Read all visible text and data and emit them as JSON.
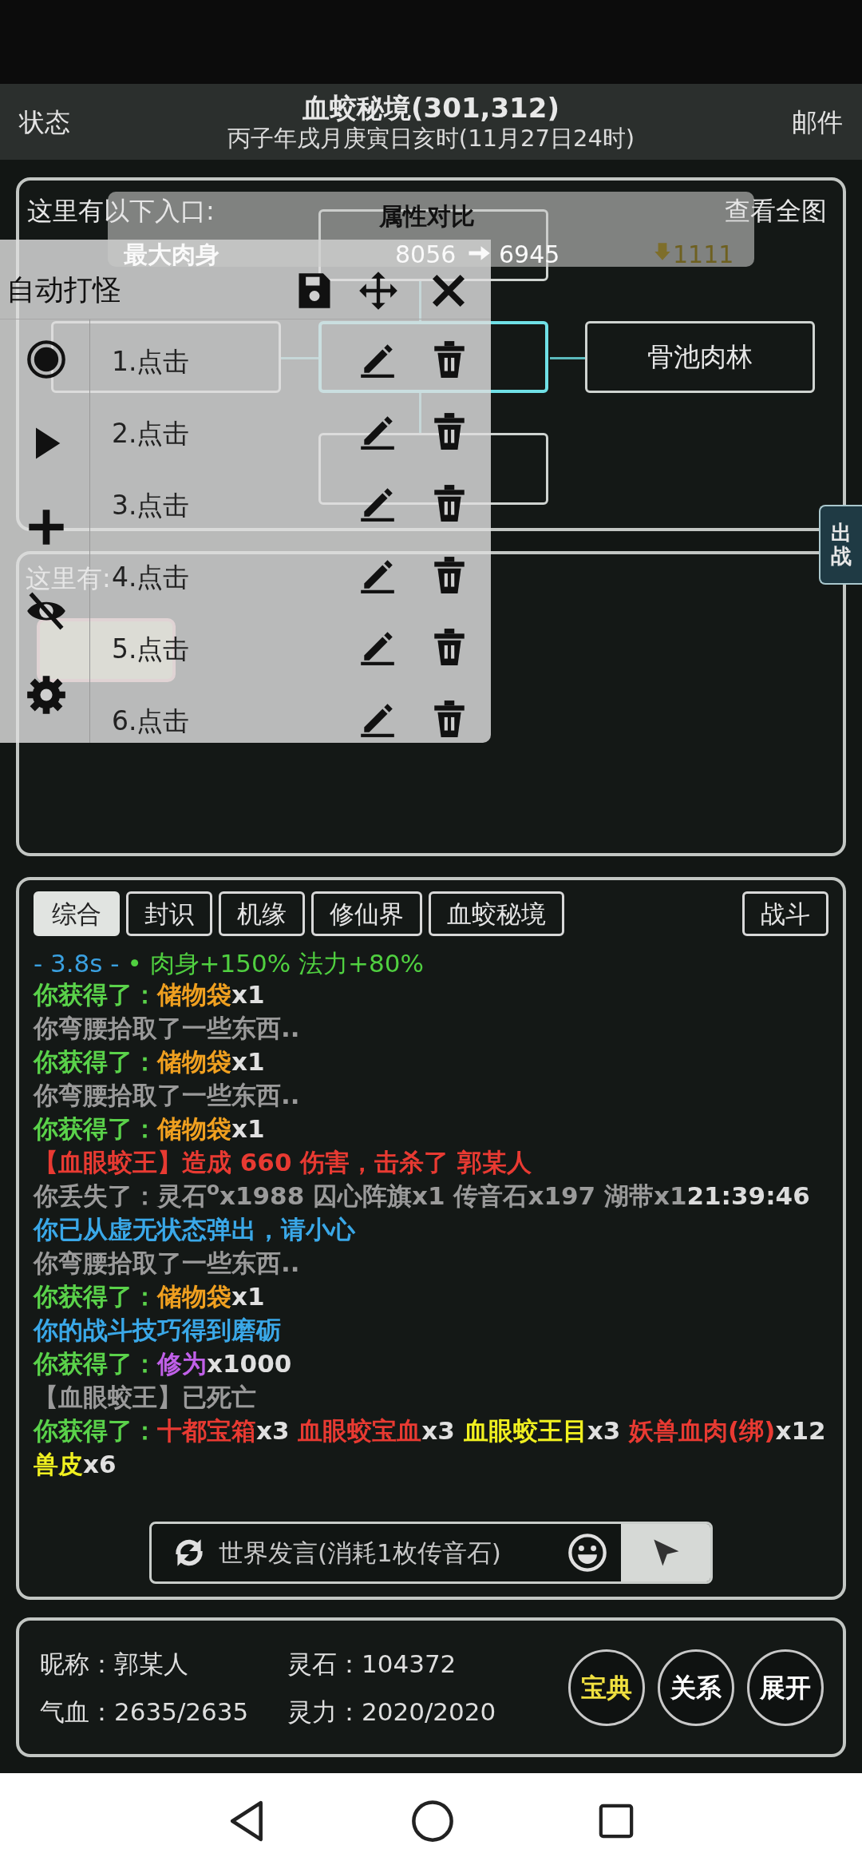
{
  "header": {
    "left": "状态",
    "title": "血蛟秘境(301,312)",
    "subtitle": "丙子年戌月庚寅日亥时(11月27日24时)",
    "right": "邮件"
  },
  "map": {
    "heading": "这里有以下入口:",
    "view_all": "查看全图",
    "nodes": [
      {
        "selected": false
      },
      {
        "selected": false
      },
      {
        "selected": true
      },
      {
        "label": "骨池肉林",
        "selected": false
      },
      {
        "selected": false
      }
    ]
  },
  "here": {
    "heading": "这里有:"
  },
  "side_tab": "出战",
  "compare": {
    "title": "属性对比",
    "rows": [
      {
        "label": "最大肉身",
        "from": "8056",
        "to": "6945",
        "diff": "1111"
      }
    ]
  },
  "auto": {
    "title": "自动打怪",
    "steps": [
      {
        "label": "1.点击"
      },
      {
        "label": "2.点击"
      },
      {
        "label": "3.点击"
      },
      {
        "label": "4.点击"
      },
      {
        "label": "5.点击"
      },
      {
        "label": "6.点击"
      }
    ]
  },
  "log": {
    "tabs": [
      {
        "label": "综合",
        "selected": true
      },
      {
        "label": "封识",
        "selected": false
      },
      {
        "label": "机缘",
        "selected": false
      },
      {
        "label": "修仙界",
        "selected": false
      },
      {
        "label": "血蛟秘境",
        "selected": false
      },
      {
        "label": "战斗",
        "selected": false
      }
    ],
    "lines": [
      {
        "kind": "timer",
        "segments": [
          {
            "text": "- 3.8s -",
            "color": "#3aa0e0"
          },
          {
            "text": " • 肉身+150% 法力+80%",
            "color": "#50d040"
          }
        ]
      },
      {
        "kind": "event",
        "segments": [
          {
            "text": "你获得了：",
            "color": "#5ad24a"
          },
          {
            "text": "储物袋",
            "color": "#f0a020"
          },
          {
            "text": "x1",
            "color": "#e0e0e0"
          }
        ]
      },
      {
        "kind": "event",
        "segments": [
          {
            "text": "你弯腰拾取了一些东西..",
            "color": "#9a9a9a"
          }
        ]
      },
      {
        "kind": "event",
        "segments": [
          {
            "text": "你获得了：",
            "color": "#5ad24a"
          },
          {
            "text": "储物袋",
            "color": "#f0a020"
          },
          {
            "text": "x1",
            "color": "#e0e0e0"
          }
        ]
      },
      {
        "kind": "event",
        "segments": [
          {
            "text": "你弯腰拾取了一些东西..",
            "color": "#9a9a9a"
          }
        ]
      },
      {
        "kind": "event",
        "segments": [
          {
            "text": "你获得了：",
            "color": "#5ad24a"
          },
          {
            "text": "储物袋",
            "color": "#f0a020"
          },
          {
            "text": "x1",
            "color": "#e0e0e0"
          }
        ]
      },
      {
        "kind": "event",
        "segments": [
          {
            "text": "【血眼蛟王】造成 660 伤害，击杀了 郭某人",
            "color": "#e83a32"
          }
        ]
      },
      {
        "kind": "event",
        "segments": [
          {
            "text": "你丢失了：灵石$^{o}$x1988 囚心阵旗x1 传音石x197 湖带x1",
            "color": "#9a9a9a"
          },
          {
            "text": "21:39:46",
            "color": "#dcdcdc"
          }
        ]
      },
      {
        "kind": "event",
        "segments": [
          {
            "text": "你已从虚无状态弹出，请小心",
            "color": "#3aa8e8"
          }
        ]
      },
      {
        "kind": "event",
        "segments": [
          {
            "text": "你弯腰拾取了一些东西..",
            "color": "#9a9a9a"
          }
        ]
      },
      {
        "kind": "event",
        "segments": [
          {
            "text": "你获得了：",
            "color": "#5ad24a"
          },
          {
            "text": "储物袋",
            "color": "#f0a020"
          },
          {
            "text": "x1",
            "color": "#e0e0e0"
          }
        ]
      },
      {
        "kind": "event",
        "segments": [
          {
            "text": "你的战斗技巧得到磨砺",
            "color": "#3aa8e8"
          }
        ]
      },
      {
        "kind": "event",
        "segments": [
          {
            "text": "你获得了：",
            "color": "#5ad24a"
          },
          {
            "text": "修为",
            "color": "#c060e8"
          },
          {
            "text": "x1000",
            "color": "#e0e0e0"
          }
        ]
      },
      {
        "kind": "event",
        "segments": [
          {
            "text": "【血眼蛟王】已死亡",
            "color": "#9a9a9a"
          }
        ]
      },
      {
        "kind": "event",
        "segments": [
          {
            "text": "你获得了：",
            "color": "#5ad24a"
          },
          {
            "text": "十都宝箱",
            "color": "#e83a32"
          },
          {
            "text": "x3 ",
            "color": "#e0e0e0"
          },
          {
            "text": "血眼蛟宝血",
            "color": "#e83a32"
          },
          {
            "text": "x3 ",
            "color": "#e0e0e0"
          },
          {
            "text": "血眼蛟王目",
            "color": "#f0f020"
          },
          {
            "text": "x3 ",
            "color": "#e0e0e0"
          },
          {
            "text": "妖兽血肉(绑)",
            "color": "#e83a32"
          },
          {
            "text": "x12 ",
            "color": "#e0e0e0"
          },
          {
            "text": "兽皮",
            "color": "#f0f020"
          },
          {
            "text": "x6",
            "color": "#e0e0e0"
          }
        ]
      }
    ],
    "input": {
      "placeholder": "世界发言(消耗1枚传音石)"
    }
  },
  "status": {
    "fields": [
      {
        "label": "昵称：",
        "value": "郭某人"
      },
      {
        "label": "灵石：",
        "value": "104372"
      },
      {
        "label": "气血：",
        "value": "2635/2635"
      },
      {
        "label": "灵力：",
        "value": "2020/2020"
      }
    ],
    "buttons": [
      {
        "label": "宝典",
        "color": "#f0e040"
      },
      {
        "label": "关系",
        "color": "#ffffff"
      },
      {
        "label": "展开",
        "color": "#ffffff"
      }
    ]
  }
}
